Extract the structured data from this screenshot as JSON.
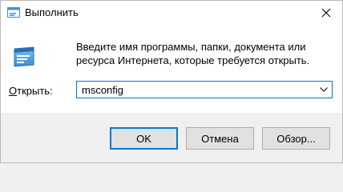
{
  "window": {
    "title": "Выполнить",
    "title_icon": "run-dialog-icon",
    "close_icon": "close-icon"
  },
  "main": {
    "icon": "run-program-icon",
    "description": "Введите имя программы, папки, документа или ресурса Интернета, которые требуется открыть.",
    "open_label_underlined": "О",
    "open_label_rest": "ткрыть:",
    "command_value": "msconfig",
    "dropdown_icon": "chevron-down-icon"
  },
  "buttons": {
    "ok_label": "OK",
    "cancel_label": "Отмена",
    "browse_label": "Обзор..."
  },
  "colors": {
    "accent": "#0078d7",
    "dialog_background": "#f0f0f0",
    "content_background": "#ffffff"
  }
}
